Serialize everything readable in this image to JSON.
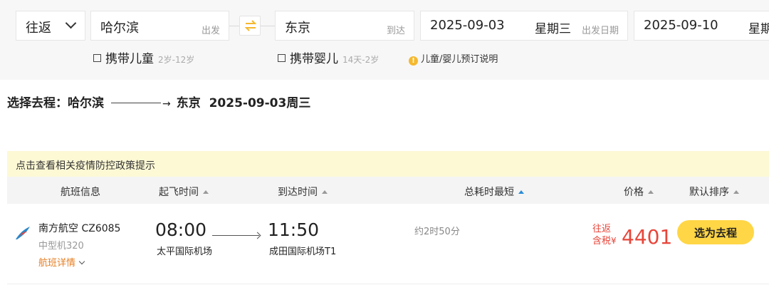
{
  "search": {
    "trip_type": "往返",
    "from_city": "哈尔滨",
    "from_label": "出发",
    "to_city": "东京",
    "to_label": "到达",
    "depart_date": "2025-09-03",
    "depart_weekday": "星期三",
    "depart_date_label": "出发日期",
    "return_date": "2025-09-10",
    "return_weekday": "星期"
  },
  "options": {
    "child_label": "携带儿童",
    "child_hint": "2岁-12岁",
    "infant_label": "携带婴儿",
    "infant_hint": "14天-2岁",
    "note": "儿童/婴儿预订说明"
  },
  "selection": {
    "prefix": "选择去程：",
    "from": "哈尔滨",
    "to": "东京",
    "date": "2025-09-03周三"
  },
  "notice": "点击查看相关疫情防控政策提示",
  "table_headers": {
    "flight_info": "航班信息",
    "depart_time": "起飞时间",
    "arrive_time": "到达时间",
    "duration": "总耗时最短",
    "price": "价格",
    "sort": "默认排序"
  },
  "flights": [
    {
      "airline": "南方航空 CZ6085",
      "aircraft": "中型机320",
      "detail_link": "航班详情",
      "depart_time": "08:00",
      "depart_airport": "太平国际机场",
      "arrive_time": "11:50",
      "arrive_airport": "成田国际机场T1",
      "duration": "约2时50分",
      "price_tag1": "往返",
      "price_tag2": "含税",
      "currency": "¥",
      "price": "4401",
      "select_label": "选为去程"
    }
  ],
  "colors": {
    "accent": "#ffd645",
    "price": "#e8463a",
    "link": "#e67e22",
    "sort_active": "#2a8bd8",
    "swap_icon": "#f5b82e"
  }
}
